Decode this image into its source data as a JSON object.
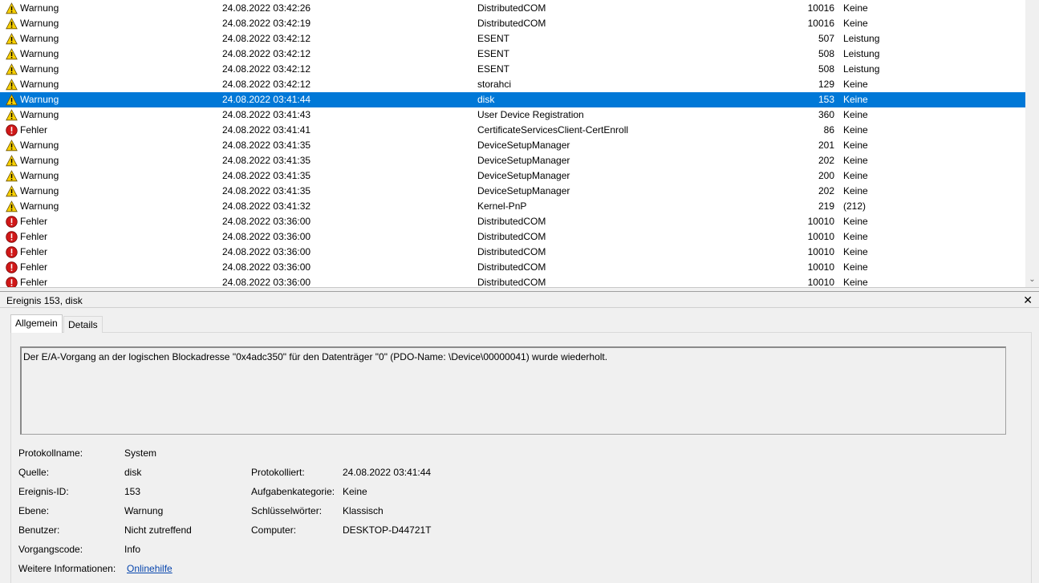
{
  "events": [
    {
      "level": "Warnung",
      "type": "warning",
      "datetime": "24.08.2022 03:42:26",
      "source": "DistributedCOM",
      "event_id": "10016",
      "category": "Keine",
      "selected": false
    },
    {
      "level": "Warnung",
      "type": "warning",
      "datetime": "24.08.2022 03:42:19",
      "source": "DistributedCOM",
      "event_id": "10016",
      "category": "Keine",
      "selected": false
    },
    {
      "level": "Warnung",
      "type": "warning",
      "datetime": "24.08.2022 03:42:12",
      "source": "ESENT",
      "event_id": "507",
      "category": "Leistung",
      "selected": false
    },
    {
      "level": "Warnung",
      "type": "warning",
      "datetime": "24.08.2022 03:42:12",
      "source": "ESENT",
      "event_id": "508",
      "category": "Leistung",
      "selected": false
    },
    {
      "level": "Warnung",
      "type": "warning",
      "datetime": "24.08.2022 03:42:12",
      "source": "ESENT",
      "event_id": "508",
      "category": "Leistung",
      "selected": false
    },
    {
      "level": "Warnung",
      "type": "warning",
      "datetime": "24.08.2022 03:42:12",
      "source": "storahci",
      "event_id": "129",
      "category": "Keine",
      "selected": false
    },
    {
      "level": "Warnung",
      "type": "warning",
      "datetime": "24.08.2022 03:41:44",
      "source": "disk",
      "event_id": "153",
      "category": "Keine",
      "selected": true
    },
    {
      "level": "Warnung",
      "type": "warning",
      "datetime": "24.08.2022 03:41:43",
      "source": "User Device Registration",
      "event_id": "360",
      "category": "Keine",
      "selected": false
    },
    {
      "level": "Fehler",
      "type": "error",
      "datetime": "24.08.2022 03:41:41",
      "source": "CertificateServicesClient-CertEnroll",
      "event_id": "86",
      "category": "Keine",
      "selected": false
    },
    {
      "level": "Warnung",
      "type": "warning",
      "datetime": "24.08.2022 03:41:35",
      "source": "DeviceSetupManager",
      "event_id": "201",
      "category": "Keine",
      "selected": false
    },
    {
      "level": "Warnung",
      "type": "warning",
      "datetime": "24.08.2022 03:41:35",
      "source": "DeviceSetupManager",
      "event_id": "202",
      "category": "Keine",
      "selected": false
    },
    {
      "level": "Warnung",
      "type": "warning",
      "datetime": "24.08.2022 03:41:35",
      "source": "DeviceSetupManager",
      "event_id": "200",
      "category": "Keine",
      "selected": false
    },
    {
      "level": "Warnung",
      "type": "warning",
      "datetime": "24.08.2022 03:41:35",
      "source": "DeviceSetupManager",
      "event_id": "202",
      "category": "Keine",
      "selected": false
    },
    {
      "level": "Warnung",
      "type": "warning",
      "datetime": "24.08.2022 03:41:32",
      "source": "Kernel-PnP",
      "event_id": "219",
      "category": "(212)",
      "selected": false
    },
    {
      "level": "Fehler",
      "type": "error",
      "datetime": "24.08.2022 03:36:00",
      "source": "DistributedCOM",
      "event_id": "10010",
      "category": "Keine",
      "selected": false
    },
    {
      "level": "Fehler",
      "type": "error",
      "datetime": "24.08.2022 03:36:00",
      "source": "DistributedCOM",
      "event_id": "10010",
      "category": "Keine",
      "selected": false
    },
    {
      "level": "Fehler",
      "type": "error",
      "datetime": "24.08.2022 03:36:00",
      "source": "DistributedCOM",
      "event_id": "10010",
      "category": "Keine",
      "selected": false
    },
    {
      "level": "Fehler",
      "type": "error",
      "datetime": "24.08.2022 03:36:00",
      "source": "DistributedCOM",
      "event_id": "10010",
      "category": "Keine",
      "selected": false
    },
    {
      "level": "Fehler",
      "type": "error",
      "datetime": "24.08.2022 03:36:00",
      "source": "DistributedCOM",
      "event_id": "10010",
      "category": "Keine",
      "selected": false
    }
  ],
  "icons": {
    "warning": "warning-icon",
    "error": "error-icon",
    "close": "close-icon",
    "scroll_down": "chevron-down-icon"
  },
  "colors": {
    "selection": "#0078d7",
    "warning": "#f8d000",
    "error": "#d01818",
    "link": "#0645ad"
  },
  "detail": {
    "title": "Ereignis 153, disk",
    "tabs": {
      "general": "Allgemein",
      "details": "Details"
    },
    "description": "Der E/A-Vorgang an der logischen Blockadresse \"0x4adc350\" für den Datenträger \"0\" (PDO-Name: \\Device\\00000041) wurde wiederholt.",
    "labels": {
      "log_name": "Protokollname:",
      "source": "Quelle:",
      "event_id": "Ereignis-ID:",
      "level": "Ebene:",
      "user": "Benutzer:",
      "opcode": "Vorgangscode:",
      "more_info": "Weitere Informationen:",
      "logged": "Protokolliert:",
      "task_category": "Aufgabenkategorie:",
      "keywords": "Schlüsselwörter:",
      "computer": "Computer:"
    },
    "values": {
      "log_name": "System",
      "source": "disk",
      "event_id": "153",
      "level": "Warnung",
      "user": "Nicht zutreffend",
      "opcode": "Info",
      "more_info": "Onlinehilfe",
      "logged": "24.08.2022 03:41:44",
      "task_category": "Keine",
      "keywords": "Klassisch",
      "computer": "DESKTOP-D44721T"
    }
  }
}
